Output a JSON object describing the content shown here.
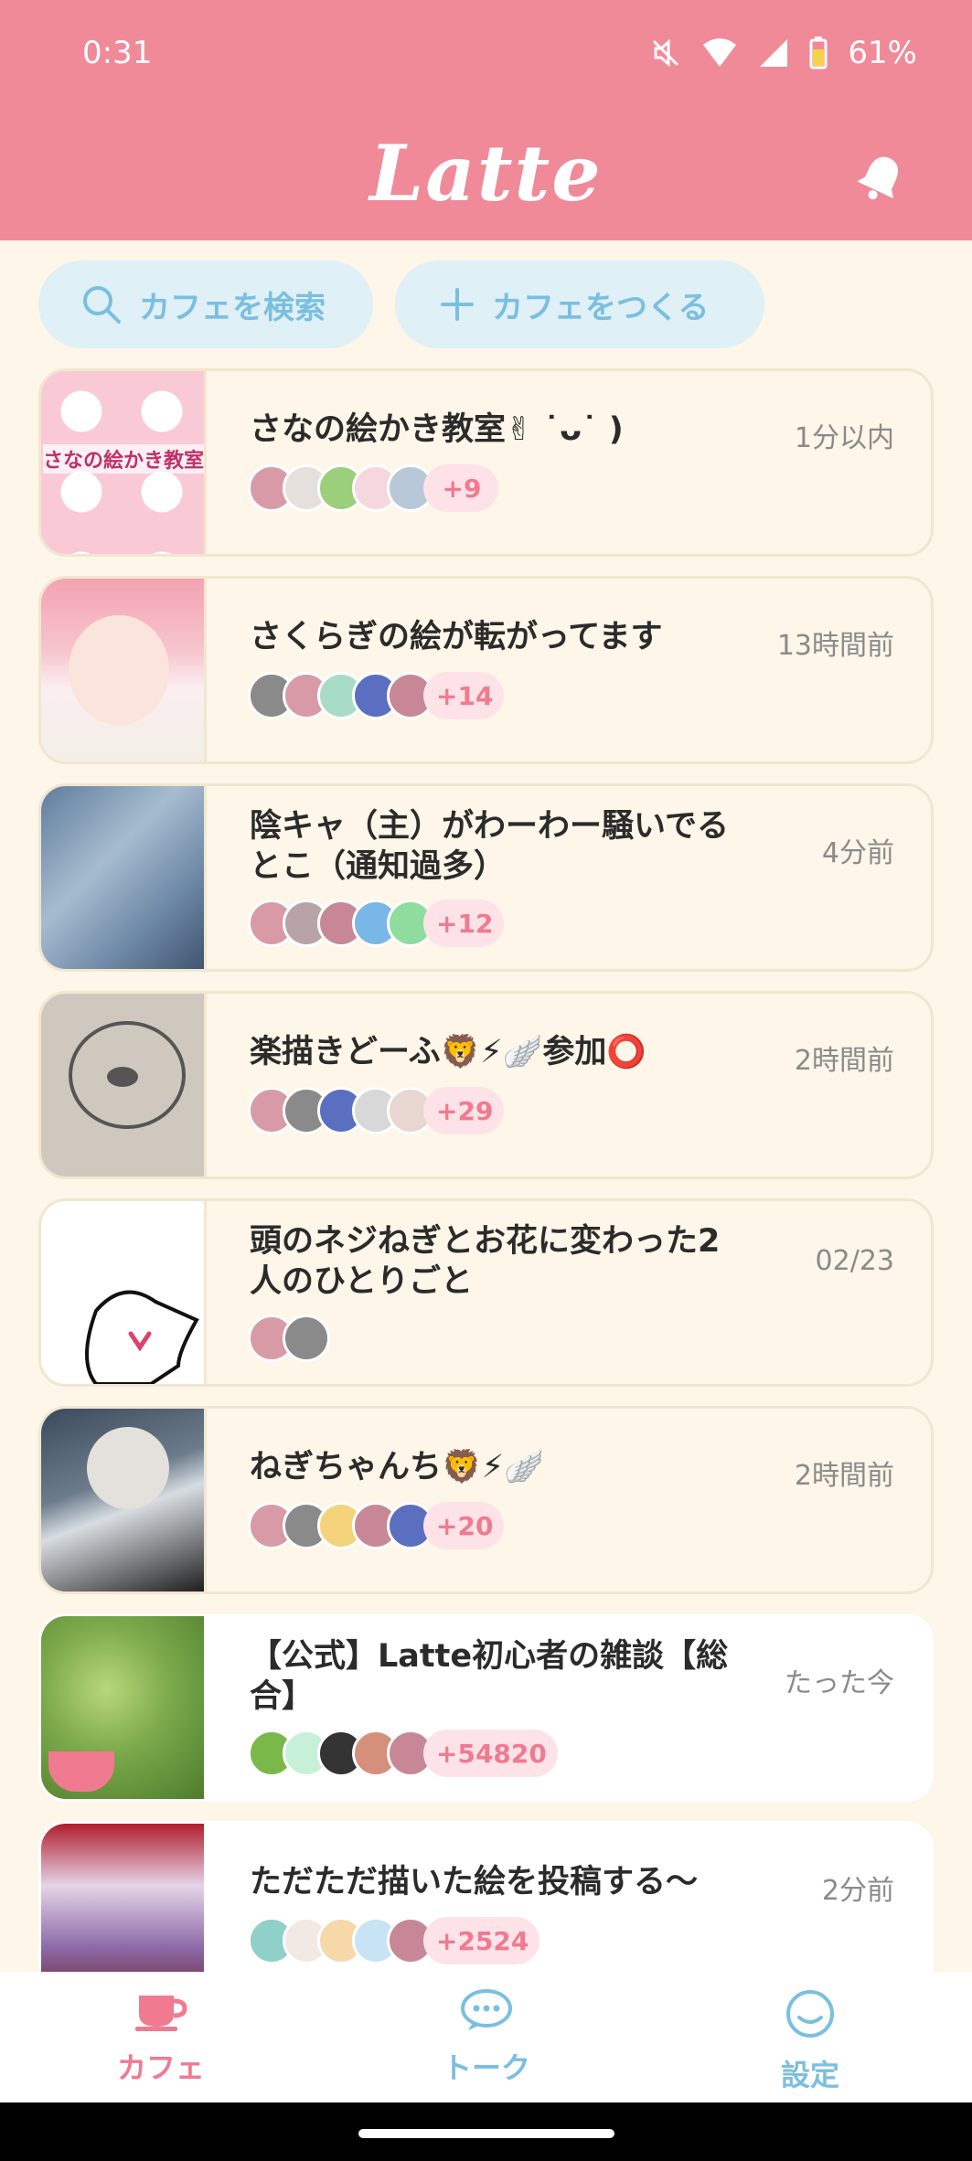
{
  "status_bar": {
    "time": "0:31",
    "battery": "61%"
  },
  "header": {
    "logo": "Latte"
  },
  "actions": {
    "search_label": "カフェを検索",
    "create_label": "カフェをつくる"
  },
  "cafes": [
    {
      "title": "さなの絵かき教室✌︎ ˙ᴗ˙ )",
      "time": "1分以内",
      "more": "+9",
      "thumb_text": "さなの絵かき教室"
    },
    {
      "title": "さくらぎの絵が転がってます",
      "time": "13時間前",
      "more": "+14"
    },
    {
      "title": "陰キャ（主）がわーわー騒いでるとこ（通知過多）",
      "time": "4分前",
      "more": "+12"
    },
    {
      "title": "楽描きどーふ🦁⚡🪽参加⭕",
      "time": "2時間前",
      "more": "+29"
    },
    {
      "title": "頭のネジねぎとお花に変わった2人のひとりごと",
      "time": "02/23",
      "more": ""
    },
    {
      "title": "ねぎちゃんち🦁⚡🪽",
      "time": "2時間前",
      "more": "+20"
    },
    {
      "title": "【公式】Latte初心者の雑談【総合】",
      "time": "たった今",
      "more": "+54820"
    },
    {
      "title": "ただただ描いた絵を投稿する〜",
      "time": "2分前",
      "more": "+2524"
    }
  ],
  "bottom_nav": {
    "cafe": "カフェ",
    "talk": "トーク",
    "settings": "設定"
  },
  "colors": {
    "header": "#f08a98",
    "background": "#fdf6e9",
    "accent_blue": "#7bbfe0",
    "badge_pink": "#f07a90"
  }
}
